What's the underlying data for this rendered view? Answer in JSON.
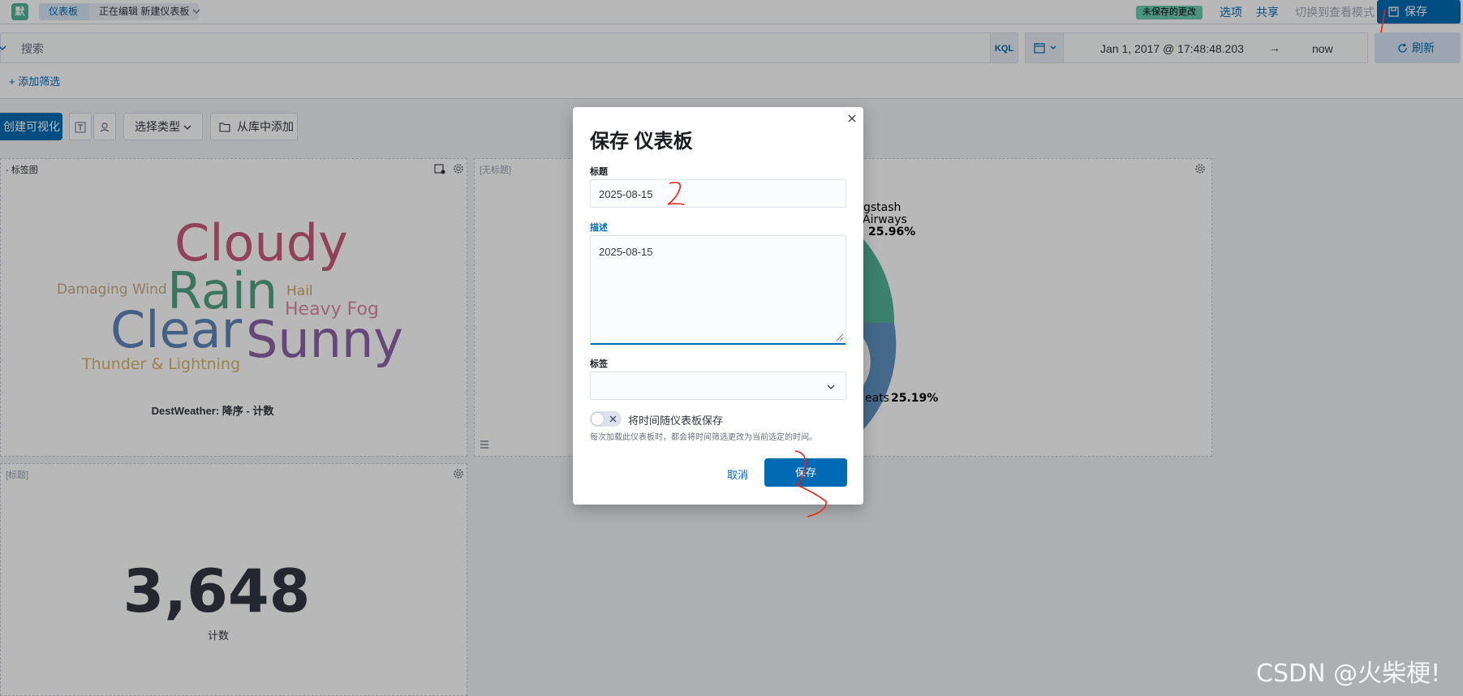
{
  "topnav": {
    "logo": "默",
    "breadcrumbs": [
      "仪表板",
      "正在编辑 新建仪表板"
    ],
    "unsaved_badge": "未保存的更改",
    "options": "选项",
    "share": "共享",
    "view_mode": "切换到查看模式",
    "save": "保存"
  },
  "querybar": {
    "search_placeholder": "搜索",
    "kql": "KQL",
    "date_start": "Jan 1, 2017 @ 17:48:48.203",
    "date_arrow": "→",
    "date_end": "now",
    "refresh": "刷新",
    "add_filter": "+ 添加筛选"
  },
  "toolbar": {
    "create_viz": "创建可视化",
    "select_type": "选择类型",
    "add_from_library": "从库中添加"
  },
  "panels": {
    "wordcloud": {
      "title": "- 标签图",
      "caption": "DestWeather: 降序 - 计数",
      "words": [
        {
          "text": "Cloudy",
          "color": "#ca5b7c"
        },
        {
          "text": "Rain",
          "color": "#54a381"
        },
        {
          "text": "Clear",
          "color": "#5f87b8"
        },
        {
          "text": "Sunny",
          "color": "#8e63a8"
        },
        {
          "text": "Damaging Wind",
          "color": "#c6ad86"
        },
        {
          "text": "Hail",
          "color": "#d7a860"
        },
        {
          "text": "Heavy Fog",
          "color": "#d98ea6"
        },
        {
          "text": "Thunder & Lightning",
          "color": "#d8b46a"
        }
      ]
    },
    "pie": {
      "title": "[无标题]",
      "label_top_1": "gstash",
      "label_top_2": "Airways",
      "label_top_pct": "25.96%",
      "label_bottom_prefix": "eats",
      "label_bottom_pct": "25.19%",
      "slice_colors": [
        "#54b399",
        "#6092c0"
      ]
    },
    "metric": {
      "title": "[标题]",
      "value": "3,648",
      "label": "计数"
    }
  },
  "modal": {
    "title": "保存 仪表板",
    "title_label": "标题",
    "title_value": "2025-08-15",
    "description_label": "描述",
    "description_value": "2025-08-15",
    "tags_label": "标签",
    "store_time_label": "将时间随仪表板保存",
    "help_text": "每次加载此仪表板时，都会将时间筛选更改为当前选定的时间。",
    "cancel": "取消",
    "save": "保存"
  },
  "watermark": "CSDN @火柴梗!"
}
